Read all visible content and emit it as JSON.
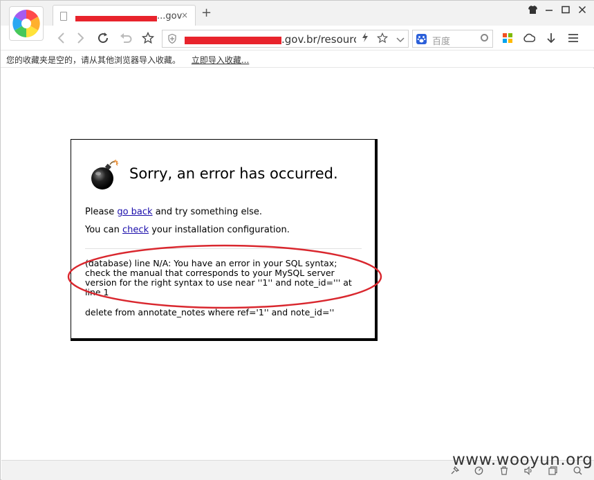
{
  "browser": {
    "tab": {
      "title": "...gov.br",
      "close_glyph": "×"
    },
    "new_tab_glyph": "+",
    "window_controls": [
      "shirt-icon",
      "minimize-icon",
      "maximize-icon",
      "close-icon"
    ],
    "url": {
      "visible_text": ".gov.br/resourc"
    },
    "search": {
      "placeholder": "百度"
    },
    "bookmarks_bar": {
      "empty_message": "您的收藏夹是空的，请从其他浏览器导入收藏。",
      "import_link": "立即导入收藏..."
    },
    "icons": {
      "back": "back-arrow-icon",
      "forward": "forward-arrow-icon",
      "reload": "reload-icon",
      "undo": "undo-close-tab-icon",
      "favorites": "star-icon"
    }
  },
  "page": {
    "heading": "Sorry, an error has occurred.",
    "line1": {
      "before": "Please ",
      "link": "go back",
      "after": " and try something else."
    },
    "line2": {
      "before": "You can ",
      "link": "check",
      "after": " your installation configuration."
    },
    "db_error": "(database) line N/A: You have an error in your SQL syntax; check the manual that corresponds to your MySQL server version for the right syntax to use near ''1'' and note_id=''' at line 1",
    "query": "delete from annotate_notes where ref='1'' and note_id=''"
  },
  "annotation": {
    "color": "#d9272e"
  },
  "watermark": "www.wooyun.org"
}
